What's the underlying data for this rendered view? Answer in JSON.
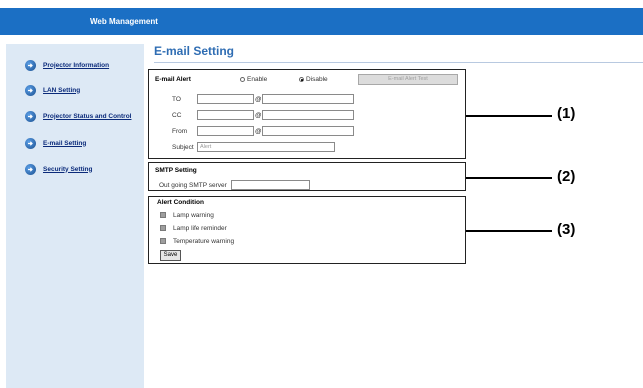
{
  "header": {
    "title": "Web Management"
  },
  "sidebar": {
    "items": [
      {
        "label": "Projector Information"
      },
      {
        "label": "LAN Setting"
      },
      {
        "label": "Projector Status and Control"
      },
      {
        "label": "E-mail Setting"
      },
      {
        "label": "Security Setting"
      }
    ]
  },
  "main": {
    "title": "E-mail Setting",
    "email_alert": {
      "label": "E-mail Alert",
      "enable_label": "Enable",
      "disable_label": "Disable",
      "selected": "Disable",
      "test_button": "E-mail Alert Test",
      "to_label": "TO",
      "cc_label": "CC",
      "from_label": "From",
      "at": "@",
      "subject_label": "Subject",
      "subject_value": "Alert"
    },
    "smtp": {
      "heading": "SMTP Setting",
      "server_label": "Out going SMTP server"
    },
    "alert_condition": {
      "heading": "Alert Condition",
      "items": [
        {
          "label": "Lamp warning"
        },
        {
          "label": "Lamp life reminder"
        },
        {
          "label": "Temperature warning"
        }
      ],
      "save_label": "Save"
    }
  },
  "callouts": [
    "(1)",
    "(2)",
    "(3)"
  ]
}
